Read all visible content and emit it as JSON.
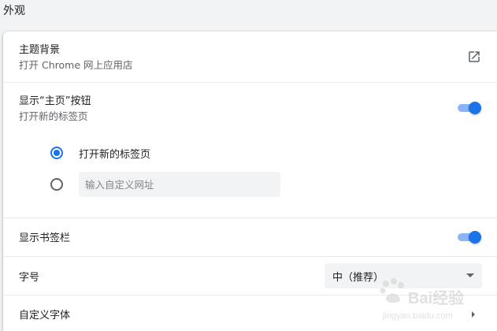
{
  "section": {
    "title": "外观"
  },
  "theme": {
    "label": "主题背景",
    "sublabel": "打开 Chrome 网上应用店",
    "icon": "open-in-new-icon"
  },
  "home_button": {
    "label": "显示“主页”按钮",
    "sublabel": "打开新的标签页",
    "enabled": true,
    "options": [
      {
        "label": "打开新的标签页",
        "selected": true
      },
      {
        "label": "",
        "selected": false
      }
    ],
    "custom_url_placeholder": "输入自定义网址",
    "custom_url_value": ""
  },
  "bookmarks_bar": {
    "label": "显示书签栏",
    "enabled": true
  },
  "font_size": {
    "label": "字号",
    "selected": "中（推荐）"
  },
  "custom_fonts": {
    "label": "自定义字体"
  },
  "watermark": {
    "text": "Bai经验",
    "sub": "jingyan.baidu.com"
  },
  "colors": {
    "accent": "#1a73e8",
    "accent_light": "#8ab4f8",
    "background": "#f1f3f4",
    "card": "#ffffff",
    "divider": "#e8eaed",
    "secondary_text": "#5f6368"
  }
}
